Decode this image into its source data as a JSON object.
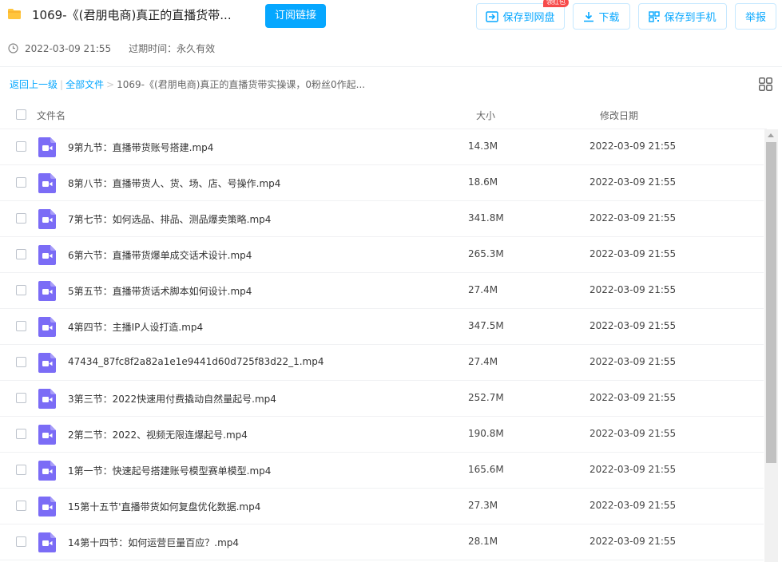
{
  "header": {
    "title": "1069-《(君朋电商)真正的直播货带...",
    "subscribe_label": "订阅链接",
    "save_disk_label": "保存到网盘",
    "badge_label": "领红包",
    "download_label": "下载",
    "save_phone_label": "保存到手机",
    "report_label": "举报",
    "share_time": "2022-03-09 21:55",
    "expire_text": "过期时间：永久有效"
  },
  "breadcrumb": {
    "back": "返回上一级",
    "all_files": "全部文件",
    "current": "1069-《(君朋电商)真正的直播货带实操课，0粉丝0作起..."
  },
  "columns": {
    "name": "文件名",
    "size": "大小",
    "date": "修改日期"
  },
  "colors": {
    "accent": "#06a7ff",
    "video_icon": "#7b6cf6",
    "folder": "#ffc53d",
    "badge": "#f74b4b"
  },
  "files": [
    {
      "name": "9第九节：直播带货账号搭建.mp4",
      "size": "14.3M",
      "date": "2022-03-09 21:55"
    },
    {
      "name": "8第八节：直播带货人、货、场、店、号操作.mp4",
      "size": "18.6M",
      "date": "2022-03-09 21:55"
    },
    {
      "name": "7第七节：如何选品、排品、测品爆卖策略.mp4",
      "size": "341.8M",
      "date": "2022-03-09 21:55"
    },
    {
      "name": "6第六节：直播带货爆单成交话术设计.mp4",
      "size": "265.3M",
      "date": "2022-03-09 21:55"
    },
    {
      "name": "5第五节：直播带货话术脚本如何设计.mp4",
      "size": "27.4M",
      "date": "2022-03-09 21:55"
    },
    {
      "name": "4第四节：主播IP人设打造.mp4",
      "size": "347.5M",
      "date": "2022-03-09 21:55"
    },
    {
      "name": "47434_87fc8f2a82a1e1e9441d60d725f83d22_1.mp4",
      "size": "27.4M",
      "date": "2022-03-09 21:55"
    },
    {
      "name": "3第三节：2022快速用付费撬动自然量起号.mp4",
      "size": "252.7M",
      "date": "2022-03-09 21:55"
    },
    {
      "name": "2第二节：2022、视频无限连爆起号.mp4",
      "size": "190.8M",
      "date": "2022-03-09 21:55"
    },
    {
      "name": "1第一节：快速起号搭建账号模型赛单模型.mp4",
      "size": "165.6M",
      "date": "2022-03-09 21:55"
    },
    {
      "name": "15第十五节'直播带货如何复盘优化数据.mp4",
      "size": "27.3M",
      "date": "2022-03-09 21:55"
    },
    {
      "name": "14第十四节：如何运营巨量百应？.mp4",
      "size": "28.1M",
      "date": "2022-03-09 21:55"
    }
  ]
}
